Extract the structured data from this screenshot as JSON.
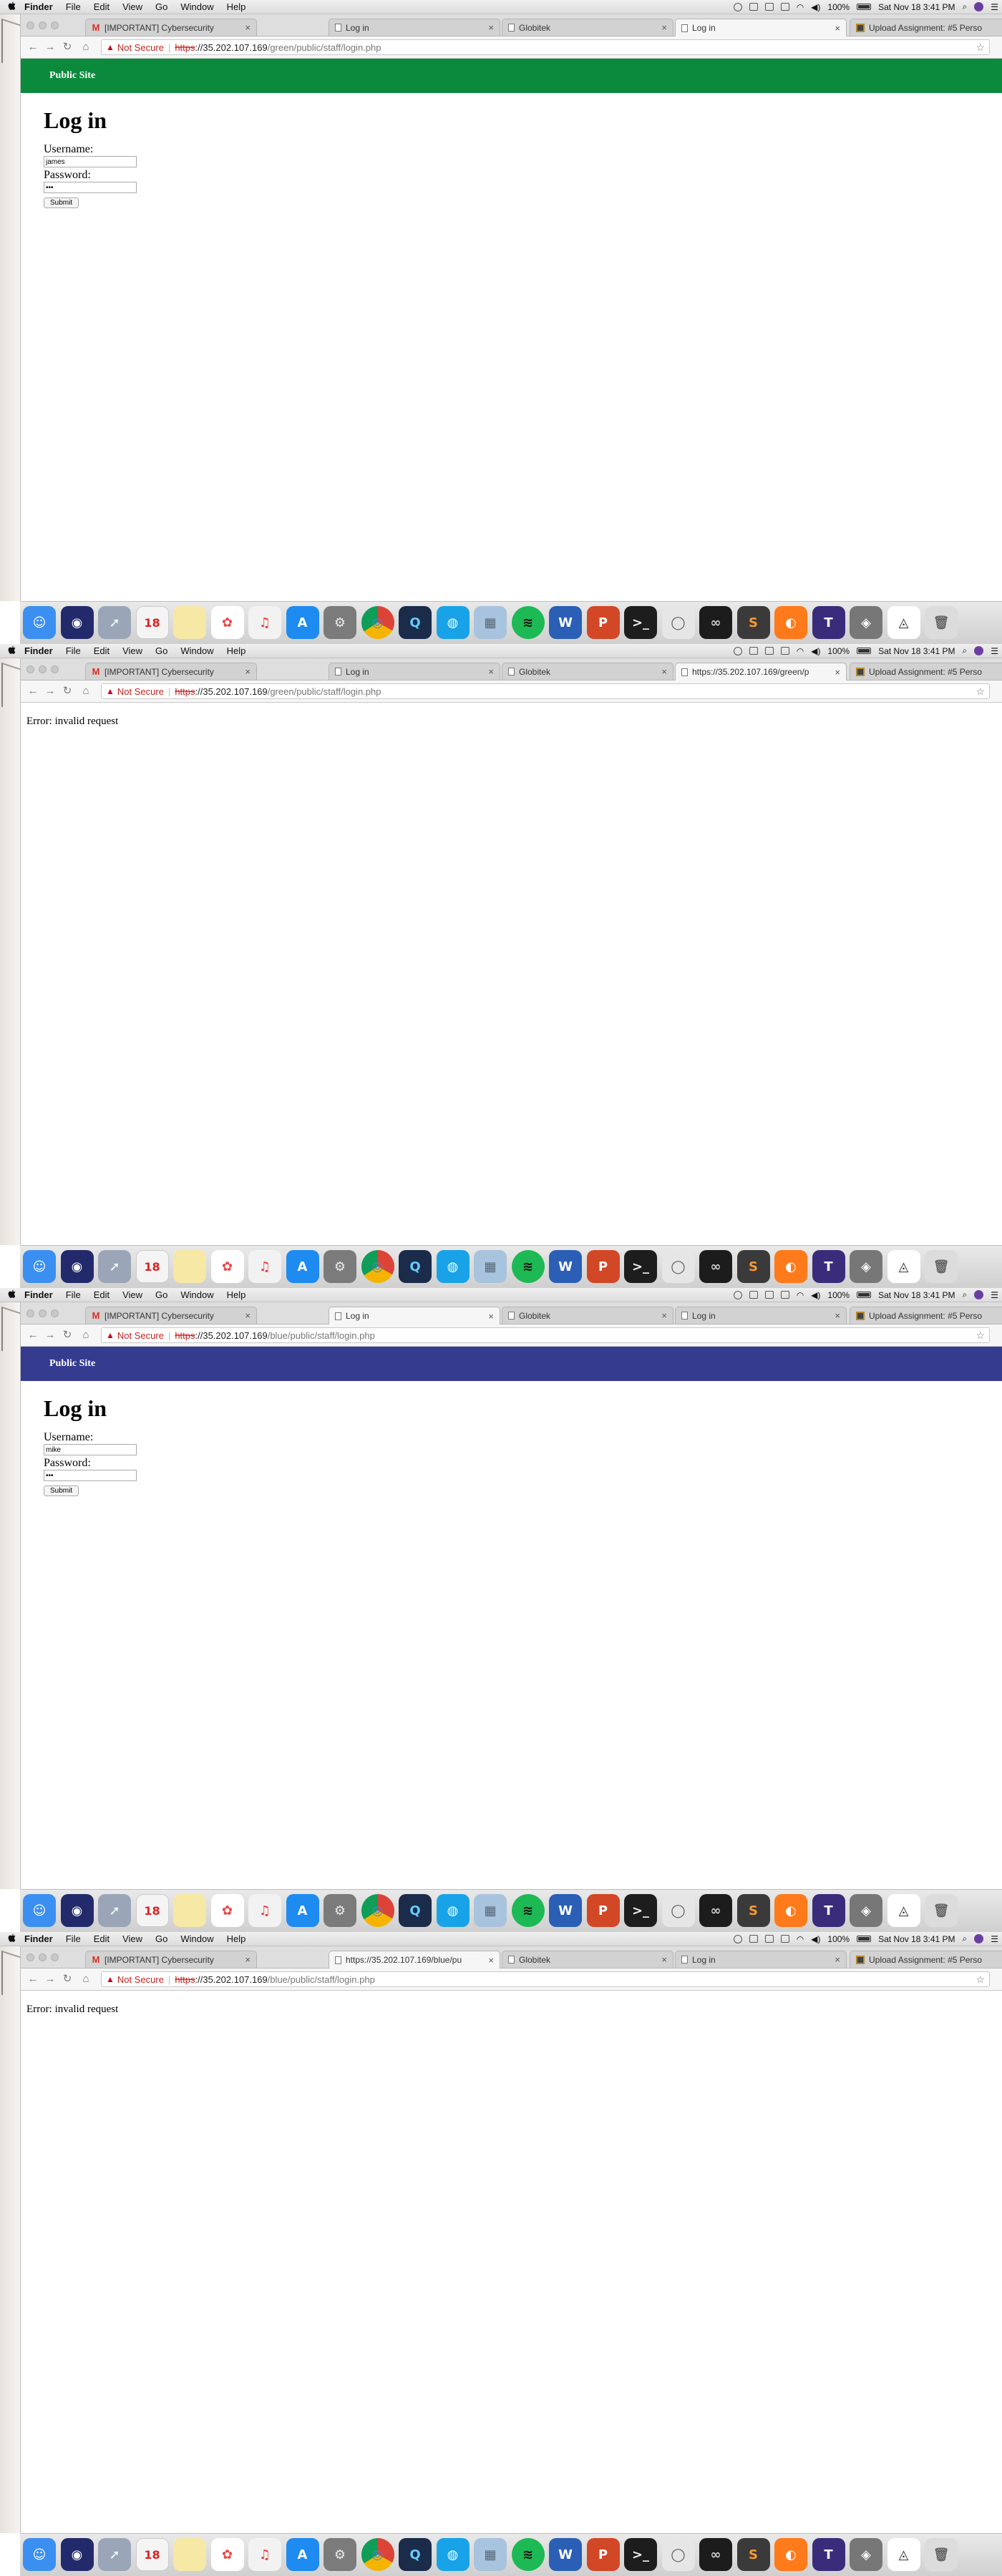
{
  "menubar": {
    "apple": "",
    "app": "Finder",
    "items": [
      "File",
      "Edit",
      "View",
      "Go",
      "Window",
      "Help"
    ],
    "battery": "100%",
    "datetime": "Sat Nov 18  3:41 PM"
  },
  "dock_icons": [
    "finder",
    "siri",
    "launchpad",
    "calendar",
    "notes",
    "photos",
    "itunes",
    "app-store",
    "system-preferences",
    "chrome",
    "quicktime",
    "safari-like",
    "photo-viewer",
    "spotify",
    "word",
    "powerpoint",
    "terminal",
    "lasso",
    "creative-cloud",
    "sublime",
    "firefox",
    "text-tool",
    "vector-tool",
    "unity",
    "trash"
  ],
  "shots": [
    {
      "tabs": [
        {
          "icon": "gmail",
          "label": "[IMPORTANT] Cybersecurity",
          "active": false
        },
        {
          "icon": "doc",
          "label": "Log in",
          "active": false
        },
        {
          "icon": "doc",
          "label": "Globitek",
          "active": false
        },
        {
          "icon": "doc",
          "label": "Log in",
          "active": true
        },
        {
          "icon": "canvas",
          "label": "Upload Assignment: #5 Perso",
          "active": false
        }
      ],
      "address": {
        "not_secure": "Not Secure",
        "scheme": "https",
        "host": "://35.202.107.169",
        "path": "/green/public/staff/login.php"
      },
      "page": {
        "type": "login",
        "site_link": "Public Site",
        "site_color": "#0b8a3c",
        "title": "Log in",
        "username_label": "Username:",
        "username_value": "james",
        "password_label": "Password:",
        "password_value": "•••",
        "submit": "Submit"
      }
    },
    {
      "tabs": [
        {
          "icon": "gmail",
          "label": "[IMPORTANT] Cybersecurity",
          "active": false
        },
        {
          "icon": "doc",
          "label": "Log in",
          "active": false
        },
        {
          "icon": "doc",
          "label": "Globitek",
          "active": false
        },
        {
          "icon": "doc",
          "label": "https://35.202.107.169/green/p",
          "active": true
        },
        {
          "icon": "canvas",
          "label": "Upload Assignment: #5 Perso",
          "active": false
        }
      ],
      "address": {
        "not_secure": "Not Secure",
        "scheme": "https",
        "host": "://35.202.107.169",
        "path": "/green/public/staff/login.php"
      },
      "page": {
        "type": "error",
        "message": "Error: invalid request"
      }
    },
    {
      "tabs": [
        {
          "icon": "gmail",
          "label": "[IMPORTANT] Cybersecurity",
          "active": false
        },
        {
          "icon": "doc",
          "label": "Log in",
          "active": true
        },
        {
          "icon": "doc",
          "label": "Globitek",
          "active": false
        },
        {
          "icon": "doc",
          "label": "Log in",
          "active": false
        },
        {
          "icon": "canvas",
          "label": "Upload Assignment: #5 Perso",
          "active": false
        }
      ],
      "address": {
        "not_secure": "Not Secure",
        "scheme": "https",
        "host": "://35.202.107.169",
        "path": "/blue/public/staff/login.php"
      },
      "page": {
        "type": "login",
        "site_link": "Public Site",
        "site_color": "#353b8f",
        "title": "Log in",
        "username_label": "Username:",
        "username_value": "mike",
        "password_label": "Password:",
        "password_value": "•••",
        "submit": "Submit"
      }
    },
    {
      "tabs": [
        {
          "icon": "gmail",
          "label": "[IMPORTANT] Cybersecurity",
          "active": false
        },
        {
          "icon": "doc",
          "label": "https://35.202.107.169/blue/pu",
          "active": true
        },
        {
          "icon": "doc",
          "label": "Globitek",
          "active": false
        },
        {
          "icon": "doc",
          "label": "Log in",
          "active": false
        },
        {
          "icon": "canvas",
          "label": "Upload Assignment: #5 Perso",
          "active": false
        }
      ],
      "address": {
        "not_secure": "Not Secure",
        "scheme": "https",
        "host": "://35.202.107.169",
        "path": "/blue/public/staff/login.php"
      },
      "page": {
        "type": "error",
        "message": "Error: invalid request"
      }
    }
  ]
}
